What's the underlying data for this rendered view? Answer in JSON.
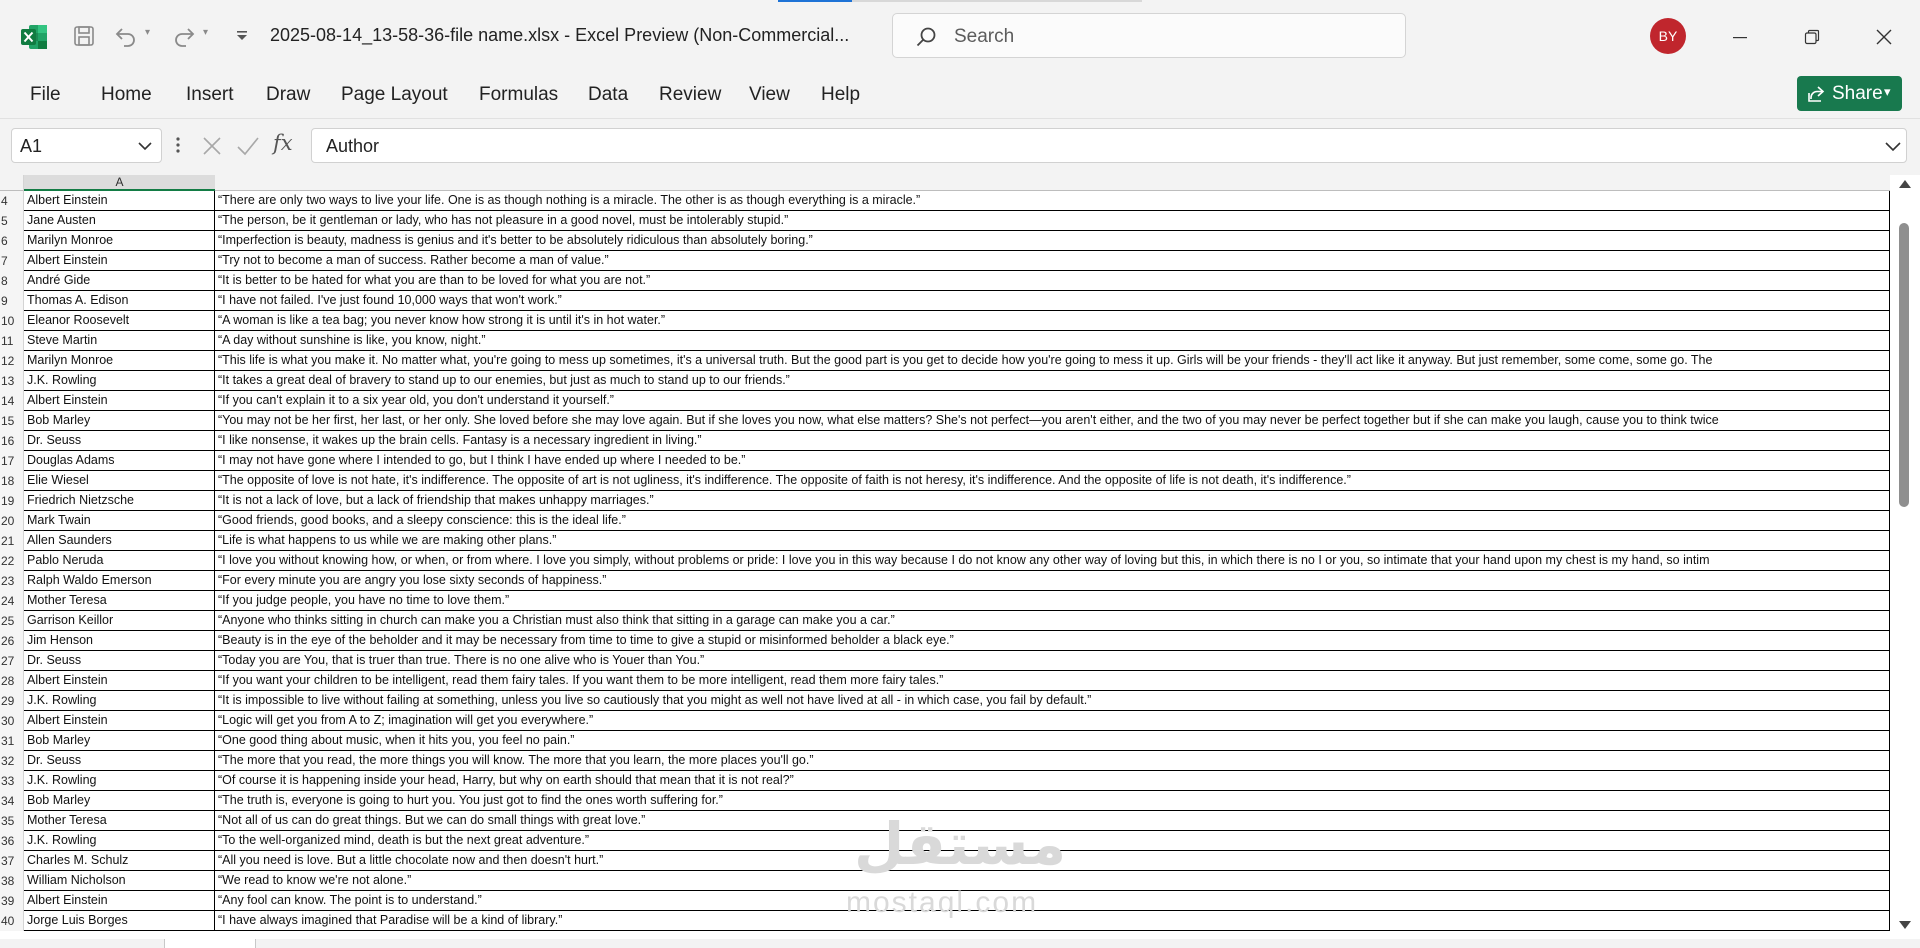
{
  "window": {
    "title": "2025-08-14_13-58-36-file name.xlsx  -  Excel Preview (Non-Commercial...",
    "search_placeholder": "Search",
    "user_initials": "BY"
  },
  "colors": {
    "excel_green": "#107c41",
    "avatar_red": "#c0262d",
    "share_green": "#18794e"
  },
  "ribbon": {
    "tabs": [
      "File",
      "Home",
      "Insert",
      "Draw",
      "Page Layout",
      "Formulas",
      "Data",
      "Review",
      "View",
      "Help"
    ],
    "share_label": "Share"
  },
  "formula_bar": {
    "cell_reference": "A1",
    "fx_label": "fx",
    "content": "Author"
  },
  "sheet": {
    "column_headers": [
      "A",
      ""
    ],
    "rows": [
      {
        "num": "4",
        "author": "Albert Einstein",
        "quote": "“There are only two ways to live your life. One is as though nothing is a miracle. The other is as though everything is a miracle.”"
      },
      {
        "num": "5",
        "author": "Jane Austen",
        "quote": "“The person, be it gentleman or lady, who has not pleasure in a good novel, must be intolerably stupid.”"
      },
      {
        "num": "6",
        "author": "Marilyn Monroe",
        "quote": "“Imperfection is beauty, madness is genius and it's better to be absolutely ridiculous than absolutely boring.”"
      },
      {
        "num": "7",
        "author": "Albert Einstein",
        "quote": "“Try not to become a man of success. Rather become a man of value.”"
      },
      {
        "num": "8",
        "author": "André Gide",
        "quote": "“It is better to be hated for what you are than to be loved for what you are not.”"
      },
      {
        "num": "9",
        "author": "Thomas A. Edison",
        "quote": "“I have not failed. I've just found 10,000 ways that won't work.”"
      },
      {
        "num": "10",
        "author": "Eleanor Roosevelt",
        "quote": "“A woman is like a tea bag; you never know how strong it is until it's in hot water.”"
      },
      {
        "num": "11",
        "author": "Steve Martin",
        "quote": "“A day without sunshine is like, you know, night.”"
      },
      {
        "num": "12",
        "author": "Marilyn Monroe",
        "quote": "“This life is what you make it. No matter what, you're going to mess up sometimes, it's a universal truth. But the good part is you get to decide how you're going to mess it up. Girls will be your friends - they'll act like it anyway. But just remember, some come, some go. The"
      },
      {
        "num": "13",
        "author": "J.K. Rowling",
        "quote": "“It takes a great deal of bravery to stand up to our enemies, but just as much to stand up to our friends.”"
      },
      {
        "num": "14",
        "author": "Albert Einstein",
        "quote": "“If you can't explain it to a six year old, you don't understand it yourself.”"
      },
      {
        "num": "15",
        "author": "Bob Marley",
        "quote": "“You may not be her first, her last, or her only. She loved before she may love again. But if she loves you now, what else matters? She's not perfect—you aren't either, and the two of you may never be perfect together but if she can make you laugh, cause you to think twice"
      },
      {
        "num": "16",
        "author": "Dr. Seuss",
        "quote": "“I like nonsense, it wakes up the brain cells. Fantasy is a necessary ingredient in living.”"
      },
      {
        "num": "17",
        "author": "Douglas Adams",
        "quote": "“I may not have gone where I intended to go, but I think I have ended up where I needed to be.”"
      },
      {
        "num": "18",
        "author": "Elie Wiesel",
        "quote": "“The opposite of love is not hate, it's indifference. The opposite of art is not ugliness, it's indifference. The opposite of faith is not heresy, it's indifference. And the opposite of life is not death, it's indifference.”"
      },
      {
        "num": "19",
        "author": "Friedrich Nietzsche",
        "quote": "“It is not a lack of love, but a lack of friendship that makes unhappy marriages.”"
      },
      {
        "num": "20",
        "author": "Mark Twain",
        "quote": "“Good friends, good books, and a sleepy conscience: this is the ideal life.”"
      },
      {
        "num": "21",
        "author": "Allen Saunders",
        "quote": "“Life is what happens to us while we are making other plans.”"
      },
      {
        "num": "22",
        "author": "Pablo Neruda",
        "quote": "“I love you without knowing how, or when, or from where. I love you simply, without problems or pride: I love you in this way because I do not know any other way of loving but this, in which there is no I or you, so intimate that your hand upon my chest is my hand, so intim"
      },
      {
        "num": "23",
        "author": "Ralph Waldo Emerson",
        "quote": "“For every minute you are angry you lose sixty seconds of happiness.”"
      },
      {
        "num": "24",
        "author": "Mother Teresa",
        "quote": "“If you judge people, you have no time to love them.”"
      },
      {
        "num": "25",
        "author": "Garrison Keillor",
        "quote": "“Anyone who thinks sitting in church can make you a Christian must also think that sitting in a garage can make you a car.”"
      },
      {
        "num": "26",
        "author": "Jim Henson",
        "quote": "“Beauty is in the eye of the beholder and it may be necessary from time to time to give a stupid or misinformed beholder a black eye.”"
      },
      {
        "num": "27",
        "author": "Dr. Seuss",
        "quote": "“Today you are You, that is truer than true. There is no one alive who is Youer than You.”"
      },
      {
        "num": "28",
        "author": "Albert Einstein",
        "quote": "“If you want your children to be intelligent, read them fairy tales. If you want them to be more intelligent, read them more fairy tales.”"
      },
      {
        "num": "29",
        "author": "J.K. Rowling",
        "quote": "“It is impossible to live without failing at something, unless you live so cautiously that you might as well not have lived at all - in which case, you fail by default.”"
      },
      {
        "num": "30",
        "author": "Albert Einstein",
        "quote": "“Logic will get you from A to Z; imagination will get you everywhere.”"
      },
      {
        "num": "31",
        "author": "Bob Marley",
        "quote": "“One good thing about music, when it hits you, you feel no pain.”"
      },
      {
        "num": "32",
        "author": "Dr. Seuss",
        "quote": "“The more that you read, the more things you will know. The more that you learn, the more places you'll go.”"
      },
      {
        "num": "33",
        "author": "J.K. Rowling",
        "quote": "“Of course it is happening inside your head, Harry, but why on earth should that mean that it is not real?”"
      },
      {
        "num": "34",
        "author": "Bob Marley",
        "quote": "“The truth is, everyone is going to hurt you. You just got to find the ones worth suffering for.”"
      },
      {
        "num": "35",
        "author": "Mother Teresa",
        "quote": "“Not all of us can do great things. But we can do small things with great love.”"
      },
      {
        "num": "36",
        "author": "J.K. Rowling",
        "quote": "“To the well-organized mind, death is but the next great adventure.”"
      },
      {
        "num": "37",
        "author": "Charles M. Schulz",
        "quote": "“All you need is love. But a little chocolate now and then doesn't hurt.”"
      },
      {
        "num": "38",
        "author": "William Nicholson",
        "quote": "“We read to know we're not alone.”"
      },
      {
        "num": "39",
        "author": "Albert Einstein",
        "quote": "“Any fool can know. The point is to understand.”"
      },
      {
        "num": "40",
        "author": "Jorge Luis Borges",
        "quote": "“I have always imagined that Paradise will be a kind of library.”"
      }
    ]
  },
  "watermark": {
    "arabic": "مستقل",
    "latin": "mostaql.com"
  }
}
